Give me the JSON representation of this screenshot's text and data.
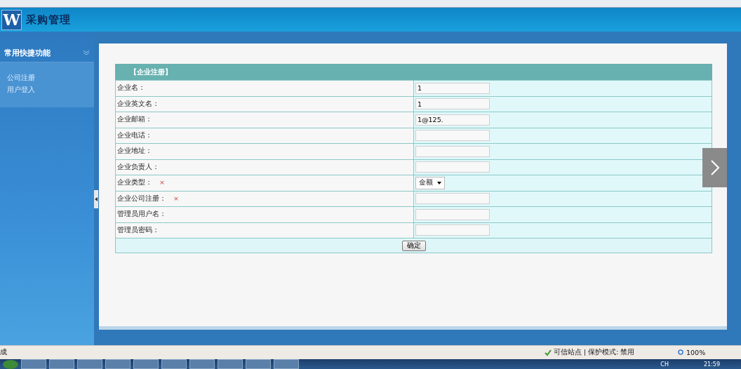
{
  "header": {
    "logo": "W",
    "title": "采购管理"
  },
  "sidebar": {
    "section_title": "常用快捷功能",
    "items": [
      {
        "label": "公司注册"
      },
      {
        "label": "用户登入"
      }
    ]
  },
  "form": {
    "title": "【企业注册】",
    "fields": [
      {
        "kind": "text",
        "label": "企业名：",
        "value": "1"
      },
      {
        "kind": "text",
        "label": "企业英文名：",
        "value": "1"
      },
      {
        "kind": "text",
        "label": "企业邮箱：",
        "value": "1@125."
      },
      {
        "kind": "text",
        "label": "企业电话："
      },
      {
        "kind": "text",
        "label": "企业地址："
      },
      {
        "kind": "text",
        "label": "企业负责人："
      },
      {
        "kind": "select",
        "label": "企业类型：",
        "value": "金额",
        "required_mark": "×"
      },
      {
        "kind": "text",
        "label": "企业公司注册：",
        "required_mark": "×"
      },
      {
        "kind": "text",
        "label": "管理员用户名："
      },
      {
        "kind": "text",
        "label": "管理员密码："
      }
    ],
    "submit": "确定"
  },
  "status_bar": {
    "status": "成",
    "zone": "可信站点 | 保护模式: 禁用",
    "zoom": "100%"
  },
  "taskbar": {
    "language": "CH",
    "clock": "21:59"
  }
}
